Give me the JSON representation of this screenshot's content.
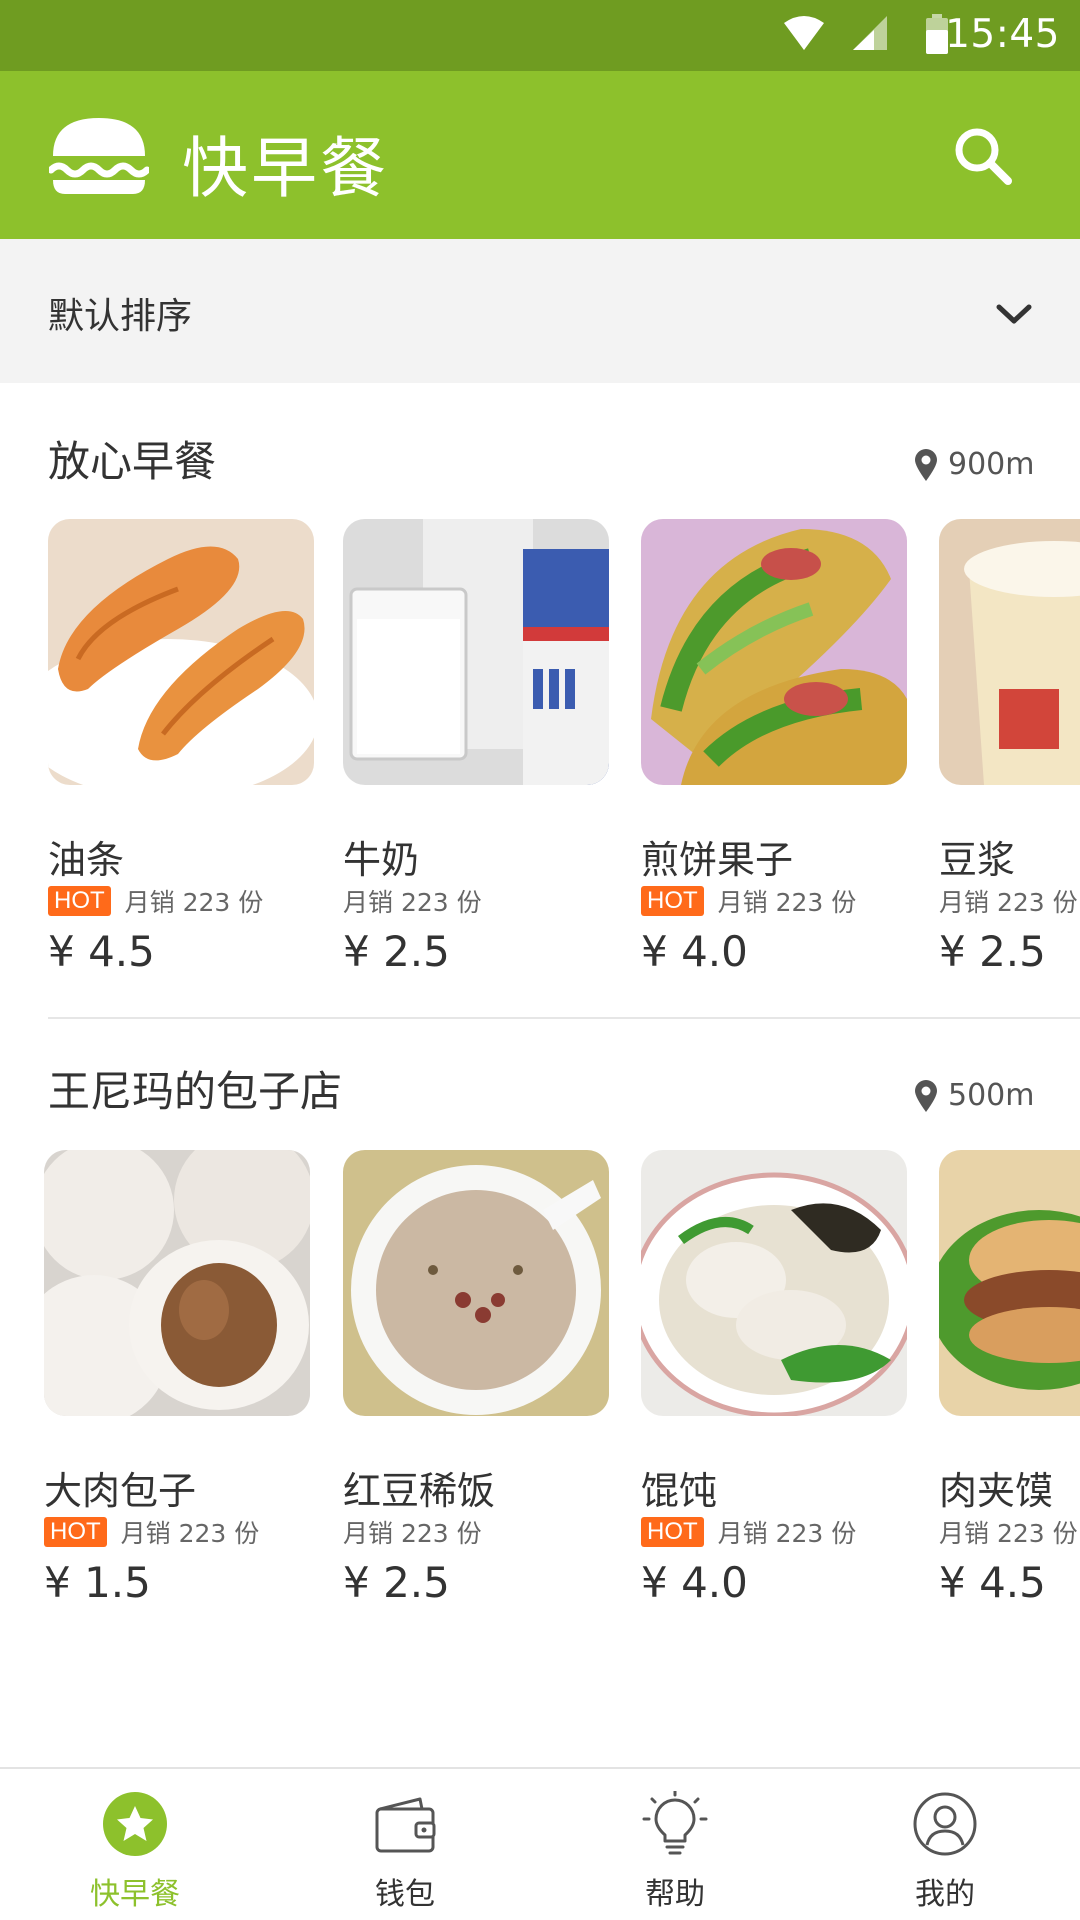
{
  "status_bar": {
    "time": "15:45"
  },
  "app_bar": {
    "title": "快早餐",
    "logo_icon": "burger-icon",
    "search_icon": "search-icon"
  },
  "sort_bar": {
    "label": "默认排序",
    "icon": "chevron-down-icon"
  },
  "colors": {
    "primary": "#8dc12c",
    "status_bar": "#6f9c21",
    "hot_badge": "#ff6a1a"
  },
  "shops": [
    {
      "name": "放心早餐",
      "distance": "900m",
      "items": [
        {
          "name": "油条",
          "hot": "HOT",
          "sales": "月销 223 份",
          "price": "¥ 4.5"
        },
        {
          "name": "牛奶",
          "hot": "",
          "sales": "月销 223 份",
          "price": "¥ 2.5"
        },
        {
          "name": "煎饼果子",
          "hot": "HOT",
          "sales": "月销 223 份",
          "price": "¥ 4.0"
        },
        {
          "name": "豆浆",
          "hot": "",
          "sales": "月销 223 份",
          "price": "¥ 2.5"
        }
      ]
    },
    {
      "name": "王尼玛的包子店",
      "distance": "500m",
      "items": [
        {
          "name": "大肉包子",
          "hot": "HOT",
          "sales": "月销 223 份",
          "price": "¥ 1.5"
        },
        {
          "name": "红豆稀饭",
          "hot": "",
          "sales": "月销 223 份",
          "price": "¥ 2.5"
        },
        {
          "name": "馄饨",
          "hot": "HOT",
          "sales": "月销 223 份",
          "price": "¥ 4.0"
        },
        {
          "name": "肉夹馍",
          "hot": "",
          "sales": "月销 223 份",
          "price": "¥ 4.5"
        }
      ]
    }
  ],
  "bottom_nav": [
    {
      "label": "快早餐",
      "icon": "star-icon",
      "active": true
    },
    {
      "label": "钱包",
      "icon": "wallet-icon",
      "active": false
    },
    {
      "label": "帮助",
      "icon": "lightbulb-icon",
      "active": false
    },
    {
      "label": "我的",
      "icon": "user-icon",
      "active": false
    }
  ]
}
